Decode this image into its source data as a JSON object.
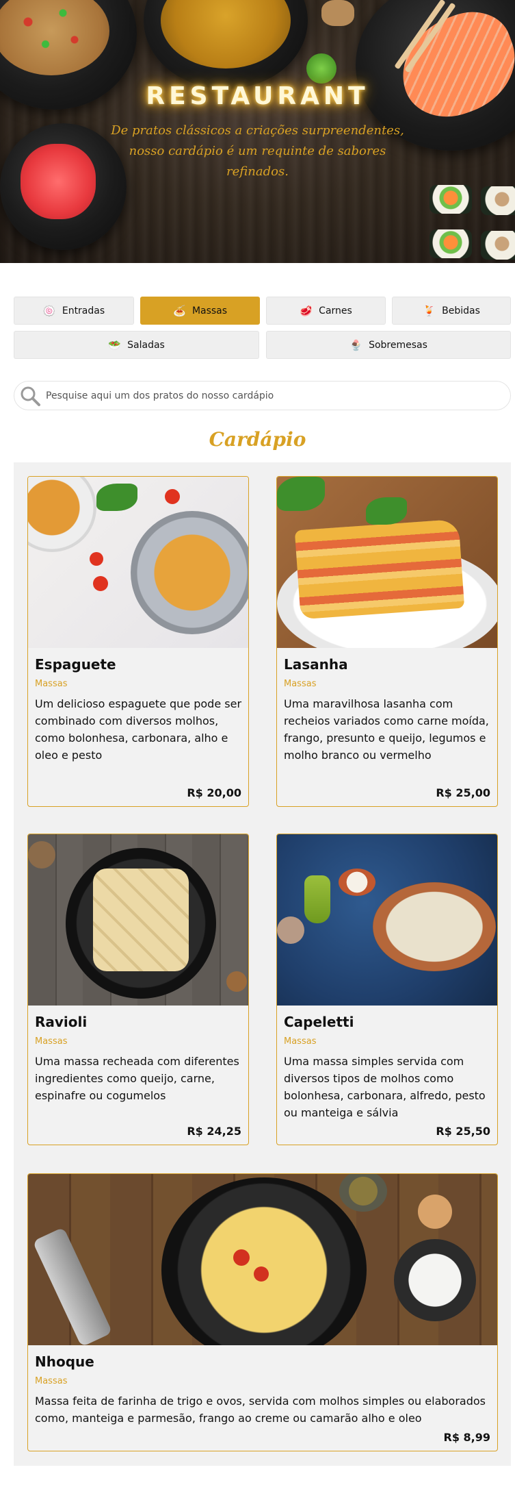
{
  "hero": {
    "title": "RESTAURANT",
    "subtitle": "De pratos clássicos a criações surpreendentes, nosso cardápio é um requinte de sabores refinados."
  },
  "categories": [
    {
      "label": "Entradas",
      "icon": "🍥",
      "icon_name": "entradas-icon",
      "active": false
    },
    {
      "label": "Massas",
      "icon": "🍝",
      "icon_name": "massas-icon",
      "active": true
    },
    {
      "label": "Carnes",
      "icon": "🥩",
      "icon_name": "carnes-icon",
      "active": false
    },
    {
      "label": "Bebidas",
      "icon": "🍹",
      "icon_name": "bebidas-icon",
      "active": false
    },
    {
      "label": "Saladas",
      "icon": "🥗",
      "icon_name": "saladas-icon",
      "active": false
    },
    {
      "label": "Sobremesas",
      "icon": "🍨",
      "icon_name": "sobremesas-icon",
      "active": false
    }
  ],
  "search": {
    "placeholder": "Pesquise aqui um dos pratos do nosso cardápio",
    "value": ""
  },
  "menu": {
    "title": "Cardápio",
    "items": [
      {
        "name": "Espaguete",
        "category": "Massas",
        "description": "Um delicioso espaguete que pode ser combinado com diversos molhos, como bolonhesa, carbonara, alho e oleo e pesto",
        "price": "R$ 20,00"
      },
      {
        "name": "Lasanha",
        "category": "Massas",
        "description": "Uma maravilhosa lasanha com recheios variados como carne moída, frango, presunto e queijo, legumos e molho branco ou vermelho",
        "price": "R$ 25,00"
      },
      {
        "name": "Ravioli",
        "category": "Massas",
        "description": "Uma massa recheada com diferentes ingredientes como queijo, carne, espinafre ou cogumelos",
        "price": "R$ 24,25"
      },
      {
        "name": "Capeletti",
        "category": "Massas",
        "description": "Uma massa simples servida com diversos tipos de molhos como bolonhesa, carbonara, alfredo, pesto ou manteiga e sálvia",
        "price": "R$ 25,50"
      },
      {
        "name": "Nhoque",
        "category": "Massas",
        "description": "Massa feita de farinha de trigo e ovos, servida com molhos simples ou elaborados como, manteiga e parmesão, frango ao creme ou camarão alho e oleo",
        "price": "R$ 8,99"
      }
    ]
  },
  "colors": {
    "accent": "#d8a124",
    "panel": "#f1f1f1",
    "button": "#efefef"
  }
}
